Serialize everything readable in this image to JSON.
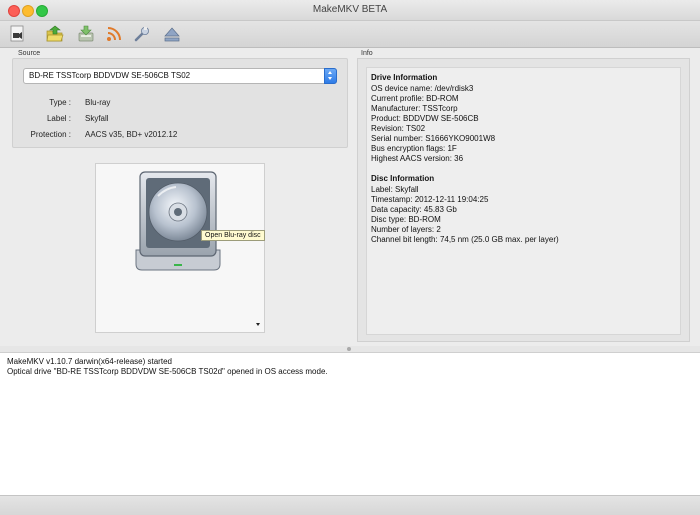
{
  "window": {
    "title": "MakeMKV BETA"
  },
  "toolbar": {
    "buttons": [
      {
        "name": "open-files-icon"
      },
      {
        "name": "open-folder-icon"
      },
      {
        "name": "backup-icon"
      },
      {
        "name": "stream-icon"
      },
      {
        "name": "preferences-icon"
      },
      {
        "name": "eject-icon"
      }
    ]
  },
  "source": {
    "label": "Source",
    "drive_selected": "BD-RE TSSTcorp BDDVDW SE-506CB TS02",
    "type_label": "Type :",
    "type_value": "Blu-ray",
    "label_label": "Label :",
    "label_value": "Skyfall",
    "protection_label": "Protection :",
    "protection_value": "AACS v35, BD+ v2012.12"
  },
  "disc": {
    "tooltip": "Open Blu-ray disc"
  },
  "info": {
    "label": "Info",
    "drive_heading": "Drive Information",
    "drive_lines": [
      "OS device name: /dev/rdisk3",
      "Current profile: BD-ROM",
      "Manufacturer: TSSTcorp",
      "Product: BDDVDW SE-506CB",
      "Revision: TS02",
      "Serial number: S1666YKO9001W8",
      "Bus encryption flags: 1F",
      "Highest AACS version: 36"
    ],
    "disc_heading": "Disc Information",
    "disc_lines": [
      "Label: Skyfall",
      "Timestamp: 2012-12-11 19:04:25",
      "Data capacity: 45.83 Gb",
      "Disc type: BD-ROM",
      "Number of layers: 2",
      "Channel bit length: 74,5 nm (25.0 GB max. per layer)"
    ]
  },
  "log": {
    "lines": [
      "MakeMKV v1.10.7 darwin(x64-release) started",
      "Optical drive \"BD-RE TSSTcorp BDDVDW SE-506CB TS02d\" opened in OS access mode."
    ]
  },
  "colors": {
    "accent": "#2f7ce8",
    "tooltip_bg": "#fffbd0",
    "close": "#fc5f57",
    "minimize": "#fdbc2e",
    "maximize": "#33c748"
  }
}
